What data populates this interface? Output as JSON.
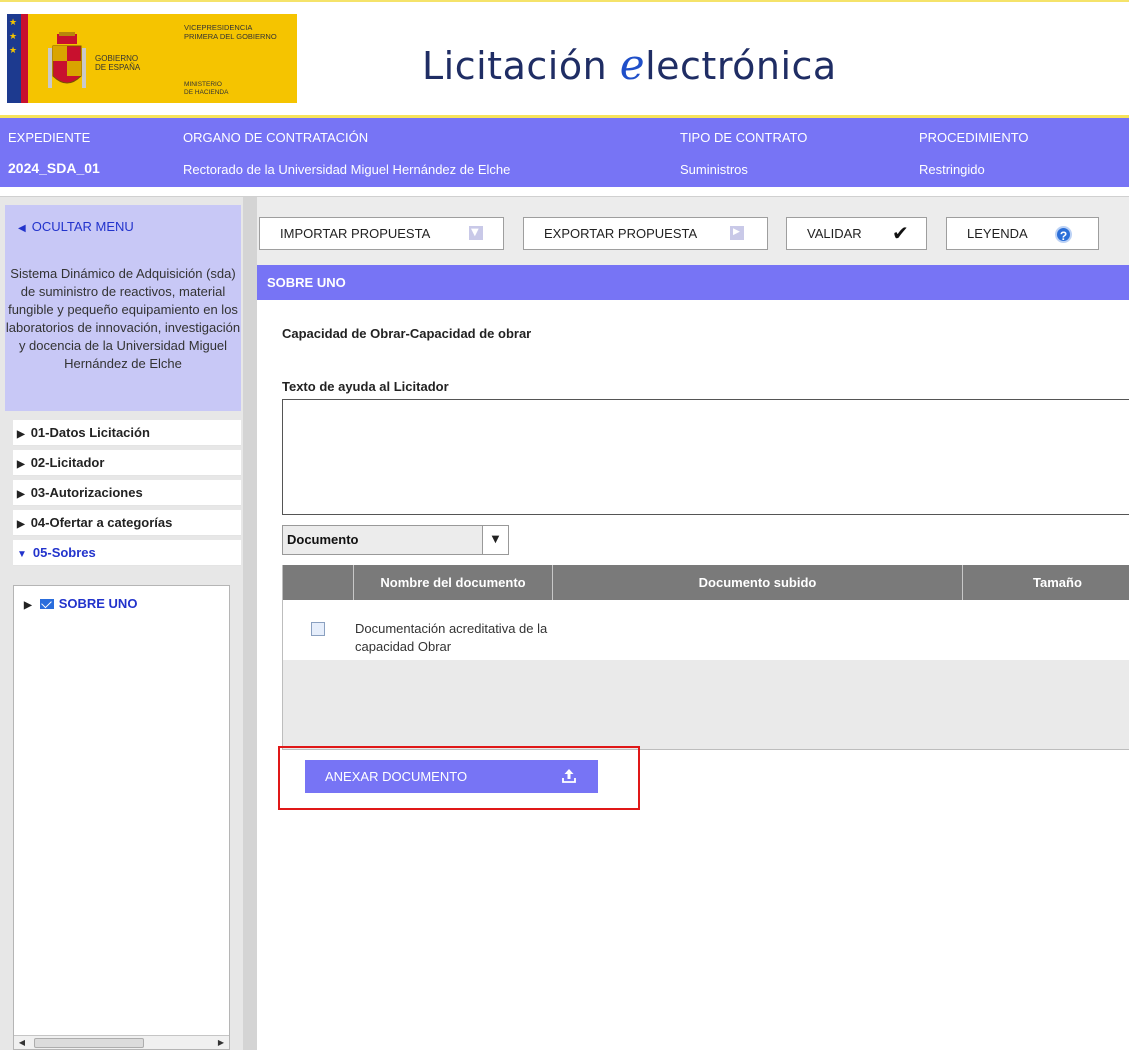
{
  "header": {
    "gov_line1": "GOBIERNO",
    "gov_line2": "DE ESPAÑA",
    "vice_line1": "VICEPRESIDENCIA",
    "vice_line2": "PRIMERA DEL GOBIERNO",
    "min_line1": "MINISTERIO",
    "min_line2": "DE HACIENDA",
    "title_prefix": "Licitación ",
    "title_logo_letter": "e",
    "title_suffix": "lectrónica"
  },
  "infobar": {
    "expediente_label": "EXPEDIENTE",
    "expediente_value": "2024_SDA_01",
    "organo_label": "ORGANO DE CONTRATACIÓN",
    "organo_value": "Rectorado de la Universidad Miguel Hernández de Elche",
    "tipo_label": "TIPO DE CONTRATO",
    "tipo_value": "Suministros",
    "procedimiento_label": "PROCEDIMIENTO",
    "procedimiento_value": "Restringido"
  },
  "sidebar": {
    "hide_menu": "OCULTAR MENU",
    "description": "Sistema Dinámico de Adquisición (sda) de suministro de reactivos, material fungible y pequeño equipamiento en los laboratorios de innovación, investigación y docencia de la Universidad Miguel Hernández de Elche",
    "items": [
      {
        "label": "01-Datos Licitación"
      },
      {
        "label": "02-Licitador"
      },
      {
        "label": "03-Autorizaciones"
      },
      {
        "label": "04-Ofertar a categorías"
      },
      {
        "label": "05-Sobres"
      }
    ],
    "tree_node": "SOBRE UNO"
  },
  "toolbar": {
    "import_label": "IMPORTAR PROPUESTA",
    "export_label": "EXPORTAR PROPUESTA",
    "validate_label": "VALIDAR",
    "legend_label": "LEYENDA"
  },
  "main": {
    "section_title": "SOBRE UNO",
    "capacity_title": "Capacidad de Obrar-Capacidad de obrar",
    "help_label": "Texto de ayuda al Licitador",
    "help_text": "",
    "doc_select_value": "Documento"
  },
  "table": {
    "headers": [
      "",
      "Nombre del documento",
      "Documento subido",
      "Tamaño"
    ],
    "rows": [
      {
        "name": "Documentación acreditativa de la capacidad Obrar",
        "uploaded": "",
        "size": ""
      }
    ]
  },
  "upload_button": "ANEXAR DOCUMENTO",
  "colors": {
    "accent": "#7774f5",
    "link": "#2233cc",
    "gov_yellow": "#f5c400",
    "highlight": "#e01818"
  }
}
